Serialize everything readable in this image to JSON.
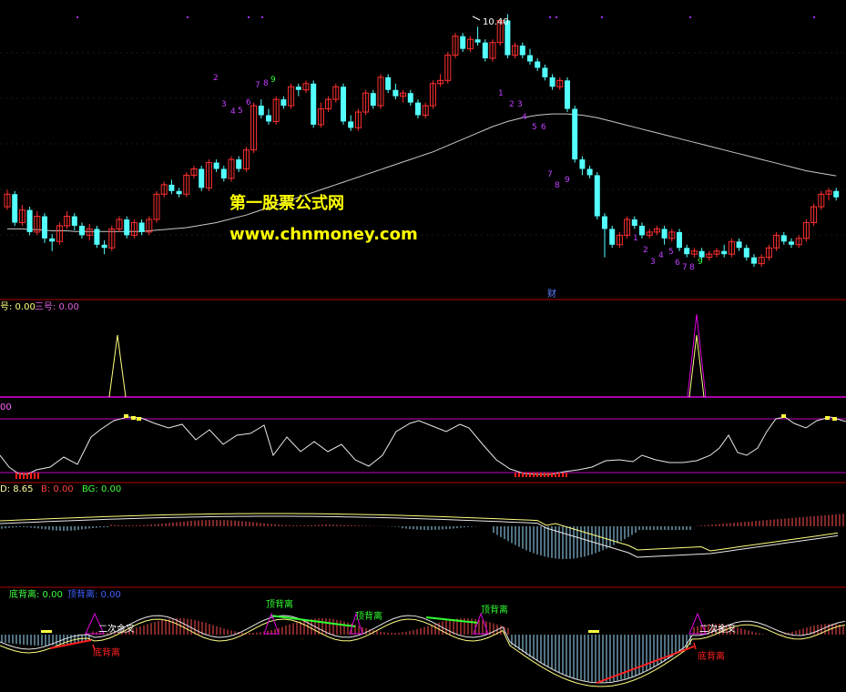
{
  "watermark": {
    "line1": "第一股票公式网",
    "line2": "www.chnmoney.com"
  },
  "colors": {
    "background": "#000000",
    "up": "#ff3030",
    "down": "#54ffff",
    "ma": "#c8c8c8",
    "panel_border": "#b00000",
    "magenta": "#e000e0",
    "yellow": "#ffff40",
    "green": "#30ff30",
    "red": "#ff2020",
    "white": "#ffffff",
    "watermark": "#ffff00",
    "purple": "#c040ff",
    "blue": "#3030ff",
    "sky": "#a0e0ff"
  },
  "icons": {
    "finance_marker": "财",
    "triangle_marker": "triangle-icon"
  },
  "panels": {
    "price": {
      "high_annotation": "10.40",
      "finance_marker": "财",
      "count_labels": [
        {
          "text": "2",
          "color": "purple"
        },
        {
          "text": "3",
          "color": "purple"
        },
        {
          "text": "4",
          "color": "purple"
        },
        {
          "text": "5",
          "color": "purple"
        },
        {
          "text": "6",
          "color": "purple"
        },
        {
          "text": "7",
          "color": "purple"
        },
        {
          "text": "8",
          "color": "purple"
        },
        {
          "text": "9",
          "color": "green"
        },
        {
          "text": "1",
          "color": "purple"
        },
        {
          "text": "2",
          "color": "purple"
        },
        {
          "text": "3",
          "color": "purple"
        },
        {
          "text": "4",
          "color": "purple"
        },
        {
          "text": "5",
          "color": "purple"
        },
        {
          "text": "6",
          "color": "purple"
        },
        {
          "text": "7",
          "color": "purple"
        },
        {
          "text": "8",
          "color": "purple"
        },
        {
          "text": "9",
          "color": "purple"
        },
        {
          "text": "1",
          "color": "purple"
        },
        {
          "text": "2",
          "color": "purple"
        },
        {
          "text": "3",
          "color": "purple"
        },
        {
          "text": "4",
          "color": "purple"
        },
        {
          "text": "5",
          "color": "purple"
        },
        {
          "text": "6",
          "color": "purple"
        },
        {
          "text": "7",
          "color": "purple"
        },
        {
          "text": "8",
          "color": "purple"
        },
        {
          "text": "9",
          "color": "green"
        }
      ]
    },
    "signal": {
      "label_a": "号: 0.00",
      "label_b": "三号: 0.00"
    },
    "oscillator": {
      "label": "00"
    },
    "macd": {
      "label_a": "D: 8.65",
      "label_b": "B: 0.00",
      "label_c": "BG: 0.00"
    },
    "divergence": {
      "label_bottom": "底背离: 0.00",
      "label_top": "顶背离: 0.00",
      "annotations": [
        {
          "text": "二次金叉",
          "color": "white"
        },
        {
          "text": "底背离",
          "color": "red"
        },
        {
          "text": "顶背离",
          "color": "green"
        },
        {
          "text": "顶背离",
          "color": "green"
        },
        {
          "text": "顶背离",
          "color": "green"
        },
        {
          "text": "二次金叉",
          "color": "white"
        },
        {
          "text": "底背离",
          "color": "red"
        }
      ]
    }
  },
  "chart_data": {
    "type": "candlestick",
    "price_high_label": 10.4,
    "candles": [
      [
        7.35,
        7.55,
        7.3,
        7.62
      ],
      [
        7.55,
        7.1,
        7.05,
        7.6
      ],
      [
        7.1,
        7.3,
        7.05,
        7.38
      ],
      [
        7.3,
        6.95,
        6.9,
        7.35
      ],
      [
        6.95,
        7.2,
        6.9,
        7.28
      ],
      [
        7.2,
        6.85,
        6.78,
        7.25
      ],
      [
        6.85,
        6.8,
        6.65,
        6.92
      ],
      [
        6.8,
        7.05,
        6.75,
        7.1
      ],
      [
        7.05,
        7.2,
        7.0,
        7.28
      ],
      [
        7.2,
        7.05,
        6.98,
        7.25
      ],
      [
        7.05,
        6.9,
        6.85,
        7.1
      ],
      [
        6.9,
        7.0,
        6.82,
        7.08
      ],
      [
        7.0,
        6.75,
        6.7,
        7.05
      ],
      [
        6.75,
        6.7,
        6.6,
        6.82
      ],
      [
        6.7,
        7.0,
        6.65,
        7.05
      ],
      [
        7.0,
        7.15,
        6.95,
        7.2
      ],
      [
        7.15,
        6.9,
        6.85,
        7.2
      ],
      [
        6.9,
        7.1,
        6.85,
        7.15
      ],
      [
        7.1,
        6.95,
        6.9,
        7.15
      ],
      [
        6.95,
        7.15,
        6.9,
        7.2
      ],
      [
        7.15,
        7.55,
        7.1,
        7.6
      ],
      [
        7.55,
        7.7,
        7.5,
        7.75
      ],
      [
        7.7,
        7.6,
        7.55,
        7.78
      ],
      [
        7.6,
        7.55,
        7.5,
        7.65
      ],
      [
        7.55,
        7.85,
        7.5,
        7.9
      ],
      [
        7.85,
        7.95,
        7.8,
        8.0
      ],
      [
        7.95,
        7.65,
        7.6,
        8.0
      ],
      [
        7.65,
        8.05,
        7.6,
        8.1
      ],
      [
        8.05,
        7.95,
        7.9,
        8.1
      ],
      [
        7.95,
        7.8,
        7.75,
        8.0
      ],
      [
        7.8,
        8.1,
        7.75,
        8.15
      ],
      [
        8.1,
        7.95,
        7.9,
        8.15
      ],
      [
        7.95,
        8.25,
        7.9,
        8.3
      ],
      [
        8.25,
        8.95,
        8.2,
        9.0
      ],
      [
        8.95,
        8.8,
        8.75,
        9.05
      ],
      [
        8.8,
        8.7,
        8.65,
        8.9
      ],
      [
        8.7,
        9.05,
        8.65,
        9.1
      ],
      [
        9.05,
        8.95,
        8.9,
        9.1
      ],
      [
        8.95,
        9.25,
        8.9,
        9.3
      ],
      [
        9.25,
        9.2,
        9.1,
        9.3
      ],
      [
        9.2,
        9.3,
        9.15,
        9.35
      ],
      [
        9.3,
        8.65,
        8.6,
        9.35
      ],
      [
        8.65,
        8.9,
        8.6,
        9.0
      ],
      [
        8.9,
        9.05,
        8.85,
        9.1
      ],
      [
        9.05,
        9.25,
        9.0,
        9.3
      ],
      [
        9.25,
        8.7,
        8.65,
        9.3
      ],
      [
        8.7,
        8.6,
        8.55,
        8.8
      ],
      [
        8.6,
        8.85,
        8.55,
        8.9
      ],
      [
        8.85,
        9.15,
        8.8,
        9.2
      ],
      [
        9.15,
        8.95,
        8.9,
        9.2
      ],
      [
        8.95,
        9.4,
        8.9,
        9.45
      ],
      [
        9.4,
        9.2,
        9.15,
        9.45
      ],
      [
        9.2,
        9.1,
        9.05,
        9.3
      ],
      [
        9.1,
        9.15,
        9.0,
        9.2
      ],
      [
        9.15,
        9.0,
        8.95,
        9.2
      ],
      [
        9.0,
        8.8,
        8.75,
        9.05
      ],
      [
        8.8,
        8.95,
        8.75,
        9.0
      ],
      [
        8.95,
        9.3,
        8.9,
        9.35
      ],
      [
        9.3,
        9.35,
        9.25,
        9.45
      ],
      [
        9.35,
        9.75,
        9.3,
        9.8
      ],
      [
        9.75,
        10.05,
        9.7,
        10.1
      ],
      [
        10.05,
        9.85,
        9.8,
        10.1
      ],
      [
        9.85,
        10.0,
        9.8,
        10.05
      ],
      [
        10.0,
        9.95,
        9.9,
        10.2
      ],
      [
        9.95,
        9.7,
        9.65,
        10.0
      ],
      [
        9.7,
        9.95,
        9.65,
        10.0
      ],
      [
        9.95,
        10.3,
        9.9,
        10.3
      ],
      [
        10.3,
        9.75,
        9.7,
        10.4
      ],
      [
        9.75,
        9.9,
        9.7,
        9.95
      ],
      [
        9.9,
        9.75,
        9.7,
        9.95
      ],
      [
        9.75,
        9.65,
        9.6,
        9.85
      ],
      [
        9.65,
        9.55,
        9.5,
        9.7
      ],
      [
        9.55,
        9.4,
        9.35,
        9.6
      ],
      [
        9.4,
        9.25,
        9.2,
        9.45
      ],
      [
        9.25,
        9.35,
        9.2,
        9.4
      ],
      [
        9.35,
        8.9,
        8.85,
        9.4
      ],
      [
        8.9,
        8.1,
        8.05,
        8.95
      ],
      [
        8.1,
        7.95,
        7.85,
        8.15
      ],
      [
        7.95,
        7.85,
        7.8,
        8.0
      ],
      [
        7.85,
        7.2,
        7.15,
        7.9
      ],
      [
        7.2,
        7.0,
        6.55,
        7.25
      ],
      [
        7.0,
        6.75,
        6.7,
        7.05
      ],
      [
        6.75,
        6.9,
        6.7,
        6.95
      ],
      [
        6.9,
        7.15,
        6.85,
        7.2
      ],
      [
        7.15,
        7.05,
        7.0,
        7.2
      ],
      [
        7.05,
        6.9,
        6.85,
        7.1
      ],
      [
        6.9,
        6.95,
        6.85,
        7.0
      ],
      [
        6.95,
        7.0,
        6.9,
        7.05
      ],
      [
        7.0,
        6.85,
        6.75,
        7.05
      ],
      [
        6.85,
        6.95,
        6.8,
        7.0
      ],
      [
        6.95,
        6.7,
        6.65,
        7.0
      ],
      [
        6.7,
        6.6,
        6.55,
        6.75
      ],
      [
        6.6,
        6.65,
        6.55,
        6.7
      ],
      [
        6.65,
        6.55,
        6.5,
        6.7
      ],
      [
        6.55,
        6.6,
        6.5,
        6.65
      ],
      [
        6.6,
        6.65,
        6.55,
        6.7
      ],
      [
        6.65,
        6.6,
        6.55,
        6.75
      ],
      [
        6.6,
        6.8,
        6.55,
        6.85
      ],
      [
        6.8,
        6.7,
        6.65,
        6.85
      ],
      [
        6.7,
        6.55,
        6.5,
        6.75
      ],
      [
        6.55,
        6.45,
        6.4,
        6.6
      ],
      [
        6.45,
        6.55,
        6.4,
        6.6
      ],
      [
        6.55,
        6.7,
        6.5,
        6.75
      ],
      [
        6.7,
        6.9,
        6.65,
        6.95
      ],
      [
        6.9,
        6.8,
        6.75,
        6.95
      ],
      [
        6.8,
        6.75,
        6.7,
        6.85
      ],
      [
        6.75,
        6.85,
        6.7,
        6.9
      ],
      [
        6.85,
        7.1,
        6.8,
        7.15
      ],
      [
        7.1,
        7.35,
        7.05,
        7.4
      ],
      [
        7.35,
        7.55,
        7.3,
        7.6
      ],
      [
        7.55,
        7.6,
        7.45,
        7.65
      ],
      [
        7.6,
        7.5,
        7.45,
        7.65
      ]
    ],
    "ma": [
      7.0,
      7.0,
      7.0,
      6.99,
      6.99,
      6.98,
      6.97,
      6.97,
      6.97,
      6.96,
      6.96,
      6.96,
      6.96,
      6.96,
      6.96,
      6.96,
      6.96,
      6.96,
      6.96,
      6.97,
      6.98,
      6.99,
      7.0,
      7.01,
      7.02,
      7.04,
      7.06,
      7.08,
      7.1,
      7.13,
      7.16,
      7.19,
      7.22,
      7.26,
      7.3,
      7.34,
      7.38,
      7.42,
      7.46,
      7.5,
      7.54,
      7.58,
      7.62,
      7.66,
      7.7,
      7.74,
      7.78,
      7.82,
      7.86,
      7.9,
      7.94,
      7.98,
      8.02,
      8.06,
      8.1,
      8.14,
      8.18,
      8.22,
      8.27,
      8.32,
      8.37,
      8.42,
      8.47,
      8.52,
      8.57,
      8.62,
      8.66,
      8.7,
      8.73,
      8.76,
      8.78,
      8.8,
      8.81,
      8.82,
      8.82,
      8.82,
      8.81,
      8.8,
      8.78,
      8.76,
      8.73,
      8.7,
      8.67,
      8.64,
      8.61,
      8.58,
      8.55,
      8.52,
      8.49,
      8.46,
      8.43,
      8.4,
      8.37,
      8.34,
      8.31,
      8.28,
      8.25,
      8.22,
      8.19,
      8.16,
      8.13,
      8.1,
      8.07,
      8.04,
      8.01,
      7.98,
      7.95,
      7.92,
      7.9,
      7.88,
      7.86,
      7.84
    ]
  }
}
